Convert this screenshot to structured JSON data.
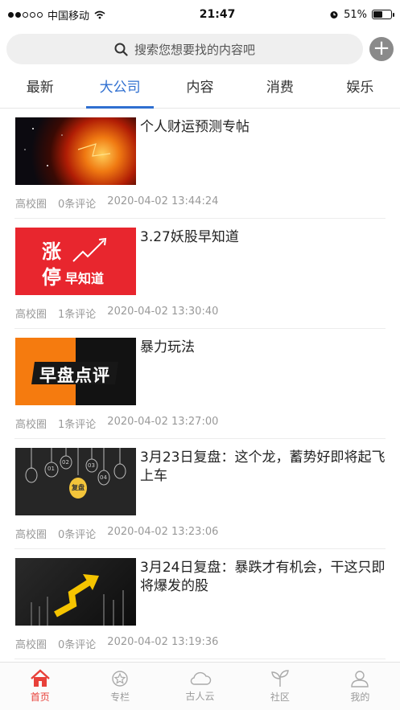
{
  "status": {
    "carrier": "中国移动",
    "time": "21:47",
    "battery": "51%",
    "battery_level": 0.51
  },
  "search": {
    "placeholder": "搜索您想要找的内容吧"
  },
  "tabs": [
    {
      "label": "最新",
      "active": false
    },
    {
      "label": "大公司",
      "active": true
    },
    {
      "label": "内容",
      "active": false
    },
    {
      "label": "消费",
      "active": false
    },
    {
      "label": "娱乐",
      "active": false
    }
  ],
  "articles": [
    {
      "title": "个人财运预测专帖",
      "source": "高校圈",
      "comments": "0条评论",
      "time": "2020-04-02 13:44:24"
    },
    {
      "title": "3.27妖股早知道",
      "source": "高校圈",
      "comments": "1条评论",
      "time": "2020-04-02 13:30:40",
      "thumb_text": [
        "涨",
        "停",
        "早知道"
      ]
    },
    {
      "title": "暴力玩法",
      "source": "高校圈",
      "comments": "1条评论",
      "time": "2020-04-02 13:27:00",
      "thumb_text": [
        "早盘点评"
      ]
    },
    {
      "title": "3月23日复盘：这个龙，蓄势好即将起飞上车",
      "source": "高校圈",
      "comments": "0条评论",
      "time": "2020-04-02 13:23:06",
      "thumb_text": [
        "复盘",
        "01",
        "02",
        "03",
        "04"
      ]
    },
    {
      "title": "3月24日复盘：暴跌才有机会，干这只即将爆发的股",
      "source": "高校圈",
      "comments": "0条评论",
      "time": "2020-04-02 13:19:36"
    }
  ],
  "nav": [
    {
      "label": "首页",
      "icon": "home-icon",
      "active": true
    },
    {
      "label": "专栏",
      "icon": "column-icon",
      "active": false
    },
    {
      "label": "古人云",
      "icon": "cloud-icon",
      "active": false
    },
    {
      "label": "社区",
      "icon": "sprout-icon",
      "active": false
    },
    {
      "label": "我的",
      "icon": "user-icon",
      "active": false
    }
  ],
  "colors": {
    "accent": "#2f6fd0",
    "nav_active": "#e8413a",
    "meta": "#999999"
  }
}
